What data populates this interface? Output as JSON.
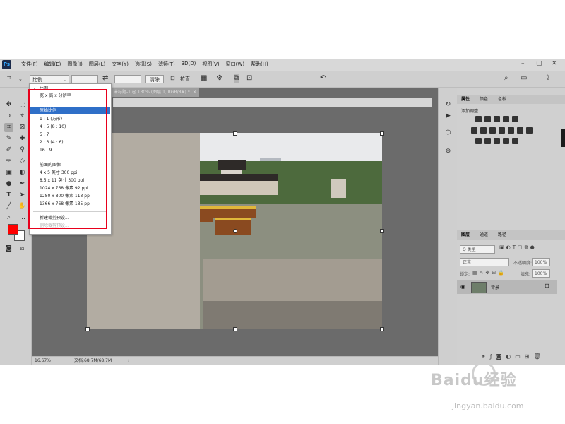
{
  "menubar": {
    "logo": "Ps",
    "items": [
      "文件(F)",
      "编辑(E)",
      "图像(I)",
      "图层(L)",
      "文字(Y)",
      "选择(S)",
      "滤镜(T)",
      "3D(D)",
      "视图(V)",
      "窗口(W)",
      "帮助(H)"
    ]
  },
  "options": {
    "ratio_value": "比例",
    "clear_label": "清除",
    "straighten_label": "拉直"
  },
  "document": {
    "tab_title": "未标题-1 @ 130% (图层 1, RGB/8#) *",
    "zoom": "16.67%",
    "doc_info": "文档:68.7M/68.7M"
  },
  "dropdown": {
    "items": [
      {
        "label": "比例",
        "checked": true
      },
      {
        "label": "宽 x 高 x 分辨率"
      },
      {
        "label": "原始比例",
        "highlighted": true
      },
      {
        "label": "1 : 1 (方形)"
      },
      {
        "label": "4 : 5 (8 : 10)"
      },
      {
        "label": "5 : 7"
      },
      {
        "label": "2 : 3 (4 : 6)"
      },
      {
        "label": "16 : 9"
      },
      {
        "label": "前面的图像"
      },
      {
        "label": "4 x 5 英寸 300 ppi"
      },
      {
        "label": "8.5 x 11 英寸 300 ppi"
      },
      {
        "label": "1024 x 768 像素 92 ppi"
      },
      {
        "label": "1280 x 800 像素 113 ppi"
      },
      {
        "label": "1366 x 768 像素 135 ppi"
      },
      {
        "label": "新建裁剪预设..."
      },
      {
        "label": "删除裁剪预设..."
      }
    ]
  },
  "adjust_panel": {
    "tabs": [
      "属性",
      "颜色",
      "色板"
    ],
    "title": "添加调整"
  },
  "layers_panel": {
    "tabs": [
      "图层",
      "通道",
      "路径"
    ],
    "kind_label": "Q 类型",
    "blend_mode": "正常",
    "opacity_label": "不透明度:",
    "opacity_value": "100%",
    "lock_label": "锁定:",
    "fill_label": "填充:",
    "fill_value": "100%",
    "layer_name": "背景"
  },
  "colors": {
    "foreground": "#ff0000",
    "background": "#ffffff",
    "highlight": "#2f6fc8",
    "annotation": "#e8001c"
  },
  "watermark": {
    "text": "Baidu经验",
    "url": "jingyan.baidu.com"
  }
}
